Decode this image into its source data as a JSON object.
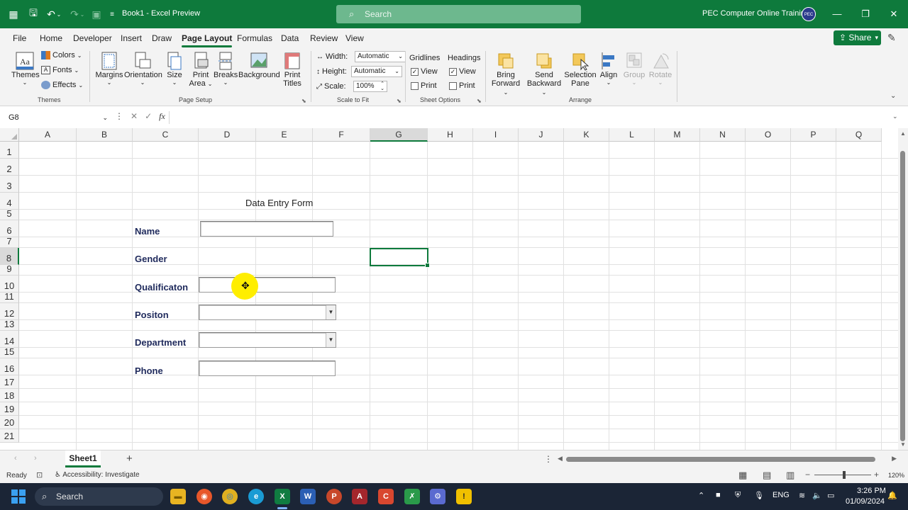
{
  "titlebar": {
    "title": "Book1  -  Excel Preview",
    "search_placeholder": "Search",
    "user": "PEC Computer Online Training",
    "avatar_text": "PEC"
  },
  "tabs": [
    "File",
    "Home",
    "Developer",
    "Insert",
    "Draw",
    "Page Layout",
    "Formulas",
    "Data",
    "Review",
    "View"
  ],
  "active_tab": "Page Layout",
  "share_label": "Share",
  "ribbon": {
    "themes": {
      "themes_label": "Themes",
      "colors_label": "Colors",
      "fonts_label": "Fonts",
      "effects_label": "Effects",
      "group_label": "Themes"
    },
    "page_setup": {
      "margins": "Margins",
      "orientation": "Orientation",
      "size": "Size",
      "print_area_1": "Print",
      "print_area_2": "Area",
      "breaks": "Breaks",
      "background": "Background",
      "print_titles_1": "Print",
      "print_titles_2": "Titles",
      "group_label": "Page Setup"
    },
    "scale_to_fit": {
      "width_label": "Width:",
      "width_value": "Automatic",
      "height_label": "Height:",
      "height_value": "Automatic",
      "scale_label": "Scale:",
      "scale_value": "100%",
      "group_label": "Scale to Fit"
    },
    "sheet_options": {
      "gridlines": "Gridlines",
      "headings": "Headings",
      "view": "View",
      "print": "Print",
      "group_label": "Sheet Options"
    },
    "arrange": {
      "bring_forward_1": "Bring",
      "bring_forward_2": "Forward",
      "send_backward_1": "Send",
      "send_backward_2": "Backward",
      "selection_pane_1": "Selection",
      "selection_pane_2": "Pane",
      "align": "Align",
      "group": "Group",
      "rotate": "Rotate",
      "group_label": "Arrange"
    }
  },
  "formula_bar": {
    "name_box": "G8",
    "fx": "fx"
  },
  "columns": [
    "A",
    "B",
    "C",
    "D",
    "E",
    "F",
    "G",
    "H",
    "I",
    "J",
    "K",
    "L",
    "M",
    "N",
    "O",
    "P",
    "Q"
  ],
  "selected_column": "G",
  "rows": [
    "1",
    "2",
    "3",
    "4",
    "5",
    "6",
    "7",
    "8",
    "9",
    "10",
    "11",
    "12",
    "13",
    "14",
    "15",
    "16",
    "17",
    "18",
    "19",
    "20",
    "21"
  ],
  "selected_row": "8",
  "form": {
    "title": "Data Entry Form",
    "labels": {
      "name": "Name",
      "gender": "Gender",
      "qualification": "Qualificaton",
      "position": "Positon",
      "department": "Department",
      "phone": "Phone"
    }
  },
  "sheet_tab": "Sheet1",
  "status": {
    "ready": "Ready",
    "accessibility": "Accessibility: Investigate",
    "zoom": "120%"
  },
  "taskbar": {
    "search": "Search",
    "lang": "ENG",
    "time": "3:26 PM",
    "date": "01/09/2024"
  }
}
